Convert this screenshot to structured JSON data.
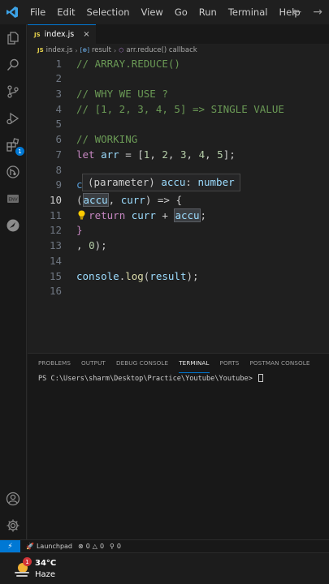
{
  "menu": [
    "File",
    "Edit",
    "Selection",
    "View",
    "Go",
    "Run",
    "Terminal",
    "Help"
  ],
  "tab": {
    "badge": "JS",
    "label": "index.js",
    "close": "×"
  },
  "breadcrumb": {
    "file_badge": "JS",
    "file": "index.js",
    "symbol1": "result",
    "symbol2": "arr.reduce() callback"
  },
  "editor": {
    "lines": [
      {
        "n": "1",
        "text": "// ARRAY.REDUCE()"
      },
      {
        "n": "2",
        "text": ""
      },
      {
        "n": "3",
        "text": "// WHY WE USE ?"
      },
      {
        "n": "4",
        "text": "// [1, 2, 3, 4, 5] => SINGLE VALUE"
      },
      {
        "n": "5",
        "text": ""
      },
      {
        "n": "6",
        "text": "// WORKING"
      },
      {
        "n": "7",
        "parts": [
          "let",
          " ",
          "arr",
          " = [",
          "1",
          ", ",
          "2",
          ", ",
          "3",
          ", ",
          "4",
          ", ",
          "5",
          "];"
        ]
      },
      {
        "n": "8",
        "text": ""
      },
      {
        "n": "9",
        "text": "c"
      },
      {
        "n": "10",
        "parts": [
          "(",
          "accu",
          ", ",
          "curr",
          ") => {"
        ]
      },
      {
        "n": "11",
        "parts": [
          "  ",
          "return",
          " ",
          "curr",
          " + ",
          "accu",
          ";"
        ]
      },
      {
        "n": "12",
        "text": "}"
      },
      {
        "n": "13",
        "parts": [
          ", ",
          "0",
          ");"
        ]
      },
      {
        "n": "14",
        "text": ""
      },
      {
        "n": "15",
        "parts": [
          "console",
          ".",
          "log",
          "(",
          "result",
          ");"
        ]
      },
      {
        "n": "16",
        "text": ""
      }
    ],
    "hover": {
      "prefix": "(parameter) ",
      "name": "accu",
      "sep": ": ",
      "type": "number"
    }
  },
  "panel": {
    "tabs": [
      "PROBLEMS",
      "OUTPUT",
      "DEBUG CONSOLE",
      "TERMINAL",
      "PORTS",
      "POSTMAN CONSOLE"
    ],
    "active_tab": "TERMINAL",
    "terminal_prompt": "PS C:\\Users\\sharm\\Desktop\\Practice\\Youtube\\Youtube> "
  },
  "statusbar": {
    "launchpad": "Launchpad",
    "errors": "0",
    "warnings": "0",
    "info": "0"
  },
  "taskbar": {
    "temperature": "34°C",
    "condition": "Haze",
    "notification_count": "1"
  },
  "colors": {
    "accent": "#0078d4",
    "comment": "#6a9955",
    "keyword": "#c586c0",
    "variable": "#9cdcfe",
    "number": "#b5cea8",
    "function": "#dcdcaa"
  }
}
